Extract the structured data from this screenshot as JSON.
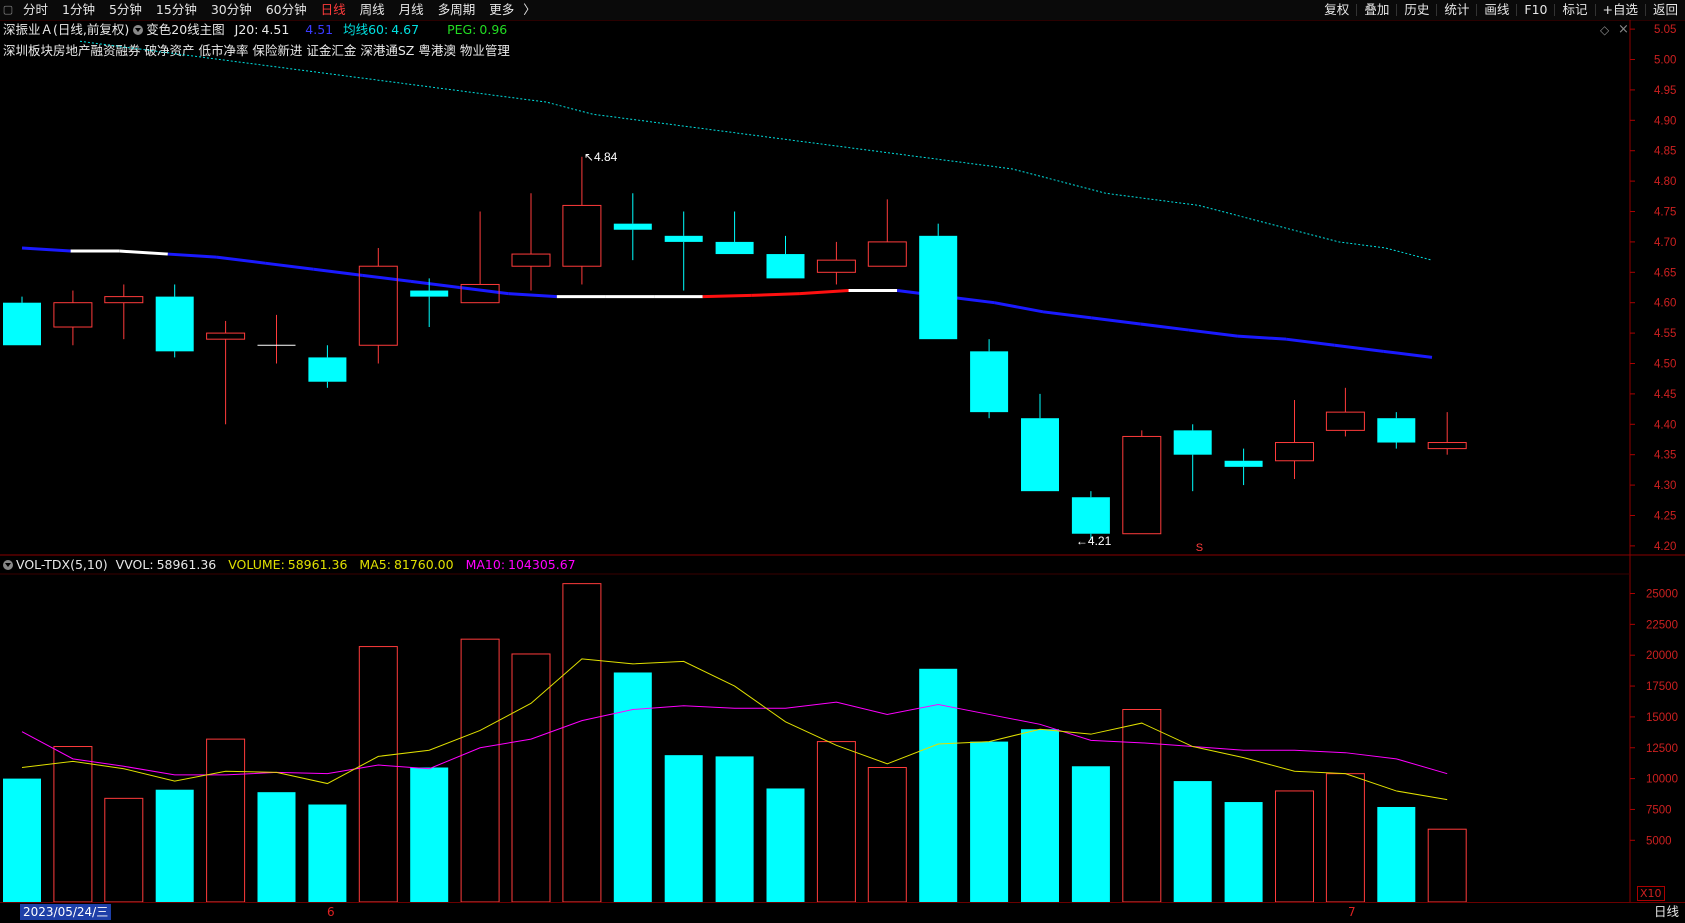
{
  "topbar": {
    "periods": [
      "分时",
      "1分钟",
      "5分钟",
      "15分钟",
      "30分钟",
      "60分钟",
      "日线",
      "周线",
      "月线",
      "多周期",
      "更多"
    ],
    "active_period": "日线",
    "right_buttons": [
      "复权",
      "叠加",
      "历史",
      "统计",
      "画线",
      "F10",
      "标记",
      "+自选",
      "返回"
    ]
  },
  "info_line": {
    "stock_name": "深振业Ａ",
    "mode": "(日线,前复权)",
    "indicator": "变色20线主图",
    "j20_label": "J20:",
    "j20_value": "4.51",
    "line_value": "4.51",
    "ma60_label": "均线60:",
    "ma60_value": "4.67",
    "peg_label": "PEG:",
    "peg_value": "0.96"
  },
  "concept_tags": "深圳板块房地产融资融券 破净资产 低市净率 保险新进 证金汇金 深港通SZ 粤港澳 物业管理",
  "volume_info": {
    "indicator": "VOL-TDX(5,10)",
    "vvol_label": "VVOL:",
    "vvol_value": "58961.36",
    "volume_label": "VOLUME:",
    "volume_value": "58961.36",
    "ma5_label": "MA5:",
    "ma5_value": "81760.00",
    "ma10_label": "MA10:",
    "ma10_value": "104305.67"
  },
  "colors": {
    "up": "#ff3b3b",
    "down": "#00ffff",
    "ma60": "#00e0e0",
    "j20_down": "#1a1aff",
    "j20_flat": "#ffffff",
    "j20_up": "#ff1010",
    "vol_ma5": "#e0e000",
    "vol_ma10": "#ff00ff",
    "axis": "#cc2020"
  },
  "footer": {
    "date": "2023/05/24/三",
    "month_labels": [
      "6",
      "7"
    ],
    "period": "日线",
    "x10": "X10"
  },
  "annotations": {
    "high": "4.84",
    "low": "4.21",
    "s_marker": "S"
  },
  "chart_data": [
    {
      "type": "candlestick",
      "title": "深振业Ａ",
      "y_ticks": [
        "5.05",
        "5.00",
        "4.95",
        "4.90",
        "4.85",
        "4.80",
        "4.75",
        "4.70",
        "4.65",
        "4.60",
        "4.55",
        "4.50",
        "4.45",
        "4.40",
        "4.35",
        "4.30",
        "4.25",
        "4.20"
      ],
      "ylim": [
        4.185,
        5.065
      ],
      "candles": [
        {
          "o": 4.6,
          "h": 4.61,
          "l": 4.53,
          "c": 4.53
        },
        {
          "o": 4.56,
          "h": 4.62,
          "l": 4.53,
          "c": 4.6
        },
        {
          "o": 4.6,
          "h": 4.63,
          "l": 4.54,
          "c": 4.61
        },
        {
          "o": 4.61,
          "h": 4.63,
          "l": 4.51,
          "c": 4.52
        },
        {
          "o": 4.54,
          "h": 4.57,
          "l": 4.4,
          "c": 4.55
        },
        {
          "o": 4.53,
          "h": 4.58,
          "l": 4.5,
          "c": 4.53
        },
        {
          "o": 4.51,
          "h": 4.53,
          "l": 4.46,
          "c": 4.47
        },
        {
          "o": 4.53,
          "h": 4.69,
          "l": 4.5,
          "c": 4.66
        },
        {
          "o": 4.62,
          "h": 4.64,
          "l": 4.56,
          "c": 4.61
        },
        {
          "o": 4.6,
          "h": 4.75,
          "l": 4.6,
          "c": 4.63
        },
        {
          "o": 4.66,
          "h": 4.78,
          "l": 4.62,
          "c": 4.68
        },
        {
          "o": 4.66,
          "h": 4.84,
          "l": 4.63,
          "c": 4.76
        },
        {
          "o": 4.73,
          "h": 4.78,
          "l": 4.67,
          "c": 4.72
        },
        {
          "o": 4.71,
          "h": 4.75,
          "l": 4.62,
          "c": 4.7
        },
        {
          "o": 4.7,
          "h": 4.75,
          "l": 4.68,
          "c": 4.68
        },
        {
          "o": 4.68,
          "h": 4.71,
          "l": 4.64,
          "c": 4.64
        },
        {
          "o": 4.65,
          "h": 4.7,
          "l": 4.63,
          "c": 4.67
        },
        {
          "o": 4.66,
          "h": 4.77,
          "l": 4.66,
          "c": 4.7
        },
        {
          "o": 4.71,
          "h": 4.73,
          "l": 4.54,
          "c": 4.54
        },
        {
          "o": 4.52,
          "h": 4.54,
          "l": 4.41,
          "c": 4.42
        },
        {
          "o": 4.41,
          "h": 4.45,
          "l": 4.29,
          "c": 4.29
        },
        {
          "o": 4.28,
          "h": 4.29,
          "l": 4.21,
          "c": 4.22
        },
        {
          "o": 4.22,
          "h": 4.39,
          "l": 4.22,
          "c": 4.38
        },
        {
          "o": 4.39,
          "h": 4.4,
          "l": 4.29,
          "c": 4.35
        },
        {
          "o": 4.34,
          "h": 4.36,
          "l": 4.3,
          "c": 4.33
        },
        {
          "o": 4.34,
          "h": 4.44,
          "l": 4.31,
          "c": 4.37
        },
        {
          "o": 4.39,
          "h": 4.46,
          "l": 4.38,
          "c": 4.42
        },
        {
          "o": 4.41,
          "h": 4.42,
          "l": 4.36,
          "c": 4.37
        },
        {
          "o": 4.36,
          "h": 4.42,
          "l": 4.35,
          "c": 4.37
        }
      ],
      "ma60": [
        5.03,
        5.02,
        5.01,
        5.0,
        4.99,
        4.98,
        4.97,
        4.96,
        4.95,
        4.94,
        4.93,
        4.91,
        4.9,
        4.89,
        4.88,
        4.87,
        4.86,
        4.85,
        4.84,
        4.83,
        4.82,
        4.8,
        4.78,
        4.77,
        4.76,
        4.74,
        4.72,
        4.7,
        4.69,
        4.67
      ],
      "j20": [
        {
          "v": 4.69,
          "trend": "down"
        },
        {
          "v": 4.685,
          "trend": "flat"
        },
        {
          "v": 4.685,
          "trend": "flat"
        },
        {
          "v": 4.68,
          "trend": "down"
        },
        {
          "v": 4.675,
          "trend": "down"
        },
        {
          "v": 4.665,
          "trend": "down"
        },
        {
          "v": 4.655,
          "trend": "down"
        },
        {
          "v": 4.645,
          "trend": "down"
        },
        {
          "v": 4.635,
          "trend": "down"
        },
        {
          "v": 4.625,
          "trend": "down"
        },
        {
          "v": 4.615,
          "trend": "down"
        },
        {
          "v": 4.61,
          "trend": "flat"
        },
        {
          "v": 4.61,
          "trend": "flat"
        },
        {
          "v": 4.61,
          "trend": "flat"
        },
        {
          "v": 4.61,
          "trend": "up"
        },
        {
          "v": 4.612,
          "trend": "up"
        },
        {
          "v": 4.615,
          "trend": "up"
        },
        {
          "v": 4.62,
          "trend": "flat"
        },
        {
          "v": 4.62,
          "trend": "down"
        },
        {
          "v": 4.61,
          "trend": "down"
        },
        {
          "v": 4.6,
          "trend": "down"
        },
        {
          "v": 4.585,
          "trend": "down"
        },
        {
          "v": 4.575,
          "trend": "down"
        },
        {
          "v": 4.565,
          "trend": "down"
        },
        {
          "v": 4.555,
          "trend": "down"
        },
        {
          "v": 4.545,
          "trend": "down"
        },
        {
          "v": 4.54,
          "trend": "down"
        },
        {
          "v": 4.53,
          "trend": "down"
        },
        {
          "v": 4.52,
          "trend": "down"
        },
        {
          "v": 4.51,
          "trend": "down"
        }
      ]
    },
    {
      "type": "bar",
      "title": "VOL-TDX(5,10)",
      "y_ticks": [
        "25000",
        "22500",
        "20000",
        "17500",
        "15000",
        "12500",
        "10000",
        "7500",
        "5000"
      ],
      "ylim": [
        0,
        26500
      ],
      "values": [
        10000,
        12600,
        8400,
        9100,
        13200,
        8900,
        7900,
        20700,
        10900,
        21300,
        20100,
        25800,
        18600,
        11900,
        11800,
        9200,
        13000,
        10900,
        18900,
        13000,
        14000,
        11000,
        15600,
        9800,
        8100,
        9000,
        10400,
        7700,
        5900
      ],
      "ma5": [
        10900,
        11400,
        10800,
        9800,
        10600,
        10500,
        9600,
        11800,
        12300,
        13900,
        16100,
        19700,
        19300,
        19500,
        17500,
        14600,
        12700,
        11200,
        12800,
        13000,
        14000,
        13600,
        14500,
        12600,
        11700,
        10600,
        10400,
        9000,
        8300
      ],
      "ma10": [
        13800,
        11600,
        11000,
        10300,
        10300,
        10500,
        10400,
        11100,
        10800,
        12500,
        13200,
        14700,
        15600,
        15900,
        15700,
        15700,
        16200,
        15200,
        16000,
        15200,
        14400,
        13100,
        12900,
        12600,
        12300,
        12300,
        12100,
        11600,
        10400
      ]
    }
  ]
}
